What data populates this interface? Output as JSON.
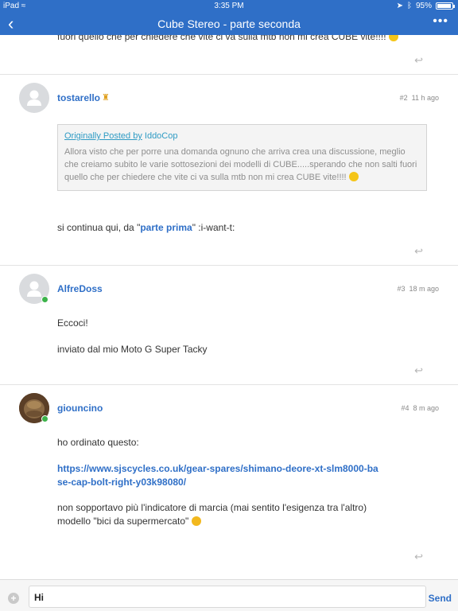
{
  "status_bar": {
    "device": "iPad",
    "time": "3:35 PM",
    "battery": "95%"
  },
  "nav": {
    "back_icon": "‹",
    "title": "Cube Stereo - parte seconda",
    "more_icon": "•••"
  },
  "posts": [
    {
      "partial_text": "fuori quello che per chiedere che vite ci va sulla mtb non mi crea CUBE vite!!!!"
    },
    {
      "username": "tostarello",
      "number": "#2",
      "time": "11 h ago",
      "quote": {
        "prefix": "Originally Posted by",
        "author": "IddoCop",
        "text": "Allora visto che per porre una domanda ognuno che arriva crea una discussione, meglio che creiamo subito le varie sottosezioni dei modelli di CUBE.....sperando che non salti fuori quello che per chiedere che vite ci va sulla mtb non mi crea CUBE vite!!!!"
      },
      "text_before": "si continua qui, da \"",
      "link": "parte prima",
      "text_after": "\"  :i-want-t:"
    },
    {
      "username": "AlfreDoss",
      "number": "#3",
      "time": "18 m ago",
      "line1": "Eccoci!",
      "line2": "inviato dal mio Moto G Super Tacky"
    },
    {
      "username": "giouncino",
      "number": "#4",
      "time": "8 m ago",
      "line1": "ho ordinato questo:",
      "url": "https://www.sjscycles.co.uk/gear-spares/shimano-deore-xt-slm8000-base-cap-bolt-right-y03k98080/",
      "line2": "non sopportavo più l'indicatore di marcia (mai sentito l'esigenza tra l'altro) modello \"bici da supermercato\""
    }
  ],
  "composer": {
    "plus_icon": "+",
    "value": "Hi",
    "send_label": "Send"
  },
  "colors": {
    "accent": "#2f6fc7",
    "online": "#3cb34a"
  }
}
